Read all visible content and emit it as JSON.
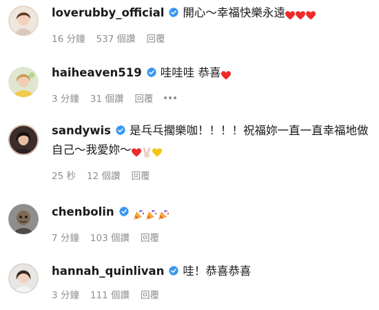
{
  "comments": [
    {
      "username": "loverubby_official",
      "text": "開心～幸福快樂永遠",
      "time": "16 分鐘",
      "views": "537 個讚",
      "reply": "回覆",
      "emoji": [
        "red-heart",
        "red-heart",
        "red-heart"
      ]
    },
    {
      "username": "haiheaven519",
      "text": "哇哇哇 恭喜",
      "time": "3 分鐘",
      "views": "31 個讚",
      "reply": "回覆",
      "emoji": [
        "red-heart"
      ]
    },
    {
      "username": "sandywis",
      "text": "是乓乓擱樂咖！！！！祝福妳一直一直幸福地做",
      "text2": "自己～我愛妳～",
      "time": "25 秒",
      "views": "12 個讚",
      "reply": "回覆",
      "emoji": [
        "red-heart",
        "victory-hand",
        "yellow-heart"
      ]
    },
    {
      "username": "chenbolin",
      "text": "",
      "time": "7 分鐘",
      "views": "103 個讚",
      "reply": "回覆",
      "emoji": [
        "party-popper",
        "party-popper",
        "party-popper"
      ]
    },
    {
      "username": "hannah_quinlivan",
      "text": "哇！恭喜恭喜",
      "time": "3 分鐘",
      "views": "111 個讚",
      "reply": "回覆",
      "emoji": []
    }
  ],
  "colors": {
    "verified": "#3897f0",
    "meta": "#8e8e8e",
    "heart": "#ed2b2b",
    "yellow_heart": "#f5c518"
  }
}
